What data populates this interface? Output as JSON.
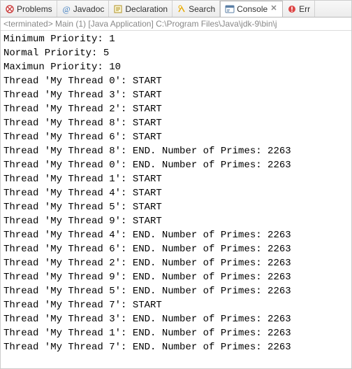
{
  "tabs": {
    "problems": {
      "label": "Problems"
    },
    "javadoc": {
      "label": "Javadoc"
    },
    "declaration": {
      "label": "Declaration"
    },
    "search": {
      "label": "Search"
    },
    "console": {
      "label": "Console"
    },
    "error": {
      "label": "Err"
    }
  },
  "header": {
    "text": "<terminated> Main (1) [Java Application] C:\\Program Files\\Java\\jdk-9\\bin\\j"
  },
  "console_output": [
    "Minimum Priority: 1",
    "Normal Priority: 5",
    "Maximun Priority: 10",
    "Thread 'My Thread 0': START",
    "Thread 'My Thread 3': START",
    "Thread 'My Thread 2': START",
    "Thread 'My Thread 8': START",
    "Thread 'My Thread 6': START",
    "Thread 'My Thread 8': END. Number of Primes: 2263",
    "Thread 'My Thread 0': END. Number of Primes: 2263",
    "Thread 'My Thread 1': START",
    "Thread 'My Thread 4': START",
    "Thread 'My Thread 5': START",
    "Thread 'My Thread 9': START",
    "Thread 'My Thread 4': END. Number of Primes: 2263",
    "Thread 'My Thread 6': END. Number of Primes: 2263",
    "Thread 'My Thread 2': END. Number of Primes: 2263",
    "Thread 'My Thread 9': END. Number of Primes: 2263",
    "Thread 'My Thread 5': END. Number of Primes: 2263",
    "Thread 'My Thread 7': START",
    "Thread 'My Thread 3': END. Number of Primes: 2263",
    "Thread 'My Thread 1': END. Number of Primes: 2263",
    "Thread 'My Thread 7': END. Number of Primes: 2263"
  ]
}
